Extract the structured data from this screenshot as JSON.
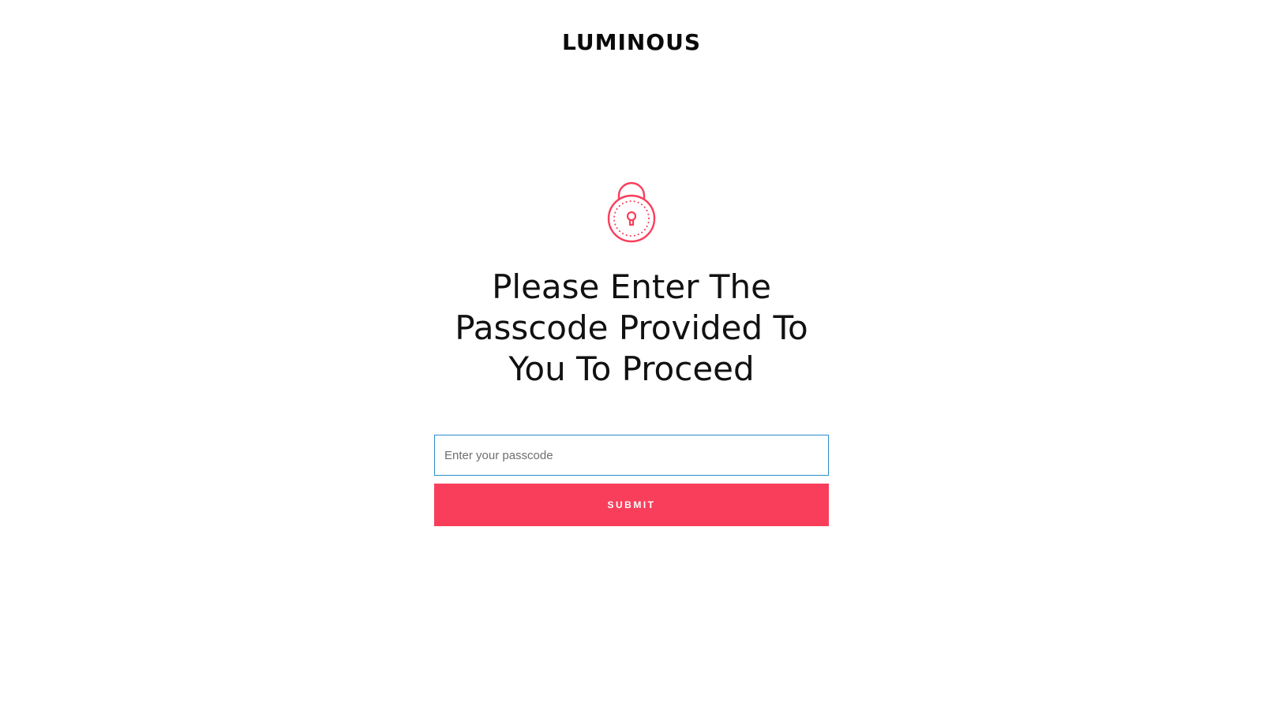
{
  "brand": {
    "logo_text": "LUMINOUS"
  },
  "icons": {
    "lock": "padlock-icon"
  },
  "colors": {
    "accent": "#f93e5c",
    "input_border": "#2b8fc7",
    "text": "#111111"
  },
  "main": {
    "heading": "Please Enter The Passcode Provided To You To Proceed"
  },
  "form": {
    "passcode_placeholder": "Enter your passcode",
    "passcode_value": "",
    "submit_label": "SUBMIT"
  }
}
